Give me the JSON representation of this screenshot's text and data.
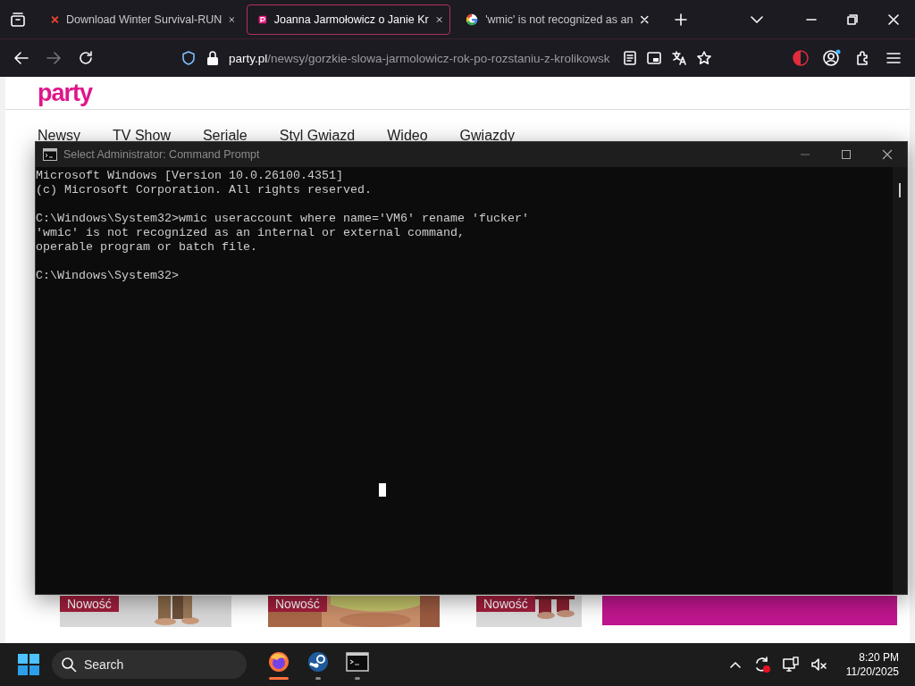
{
  "browser": {
    "tabs": [
      {
        "title": "Download Winter Survival-RUN",
        "selected": false
      },
      {
        "title": "Joanna Jarmołowicz o Janie Kr",
        "selected": true
      },
      {
        "title": "'wmic' is not recognized as an",
        "selected": false
      }
    ],
    "nav_buttons": [
      {
        "kind": "back",
        "disabled": false
      },
      {
        "kind": "forward",
        "disabled": true
      },
      {
        "kind": "reload",
        "disabled": false
      }
    ],
    "url": {
      "host": "party.pl",
      "path": "/newsy/gorzkie-slowa-jarmolowicz-rok-po-rozstaniu-z-krolikowsk"
    }
  },
  "page": {
    "logo": "party",
    "nav": [
      "Newsy",
      "TV Show",
      "Seriale",
      "Styl Gwiazd",
      "Wideo",
      "Gwiazdy"
    ],
    "cards": [
      {
        "badge": "Nowość",
        "kind": "picture"
      },
      {
        "badge": "Nowość",
        "kind": "picture"
      },
      {
        "badge": "Nowość",
        "kind": "picture"
      }
    ]
  },
  "cmd": {
    "title": "Select Administrator: Command Prompt",
    "blocks": [
      [
        "Microsoft Windows [Version 10.0.26100.4351]",
        "(c) Microsoft Corporation. All rights reserved."
      ],
      [
        "C:\\Windows\\System32>wmic useraccount where name='VM6' rename 'fucker'",
        "'wmic' is not recognized as an internal or external command,",
        "operable program or batch file."
      ],
      [
        "C:\\Windows\\System32>"
      ]
    ]
  },
  "taskbar": {
    "search": {
      "placeholder": "Search"
    },
    "apps": [
      {
        "kind": "firefox",
        "active": true
      },
      {
        "kind": "steam",
        "active": false
      },
      {
        "kind": "terminal",
        "active": false
      }
    ],
    "time": "8:20 PM",
    "date": "11/20/2025"
  }
}
